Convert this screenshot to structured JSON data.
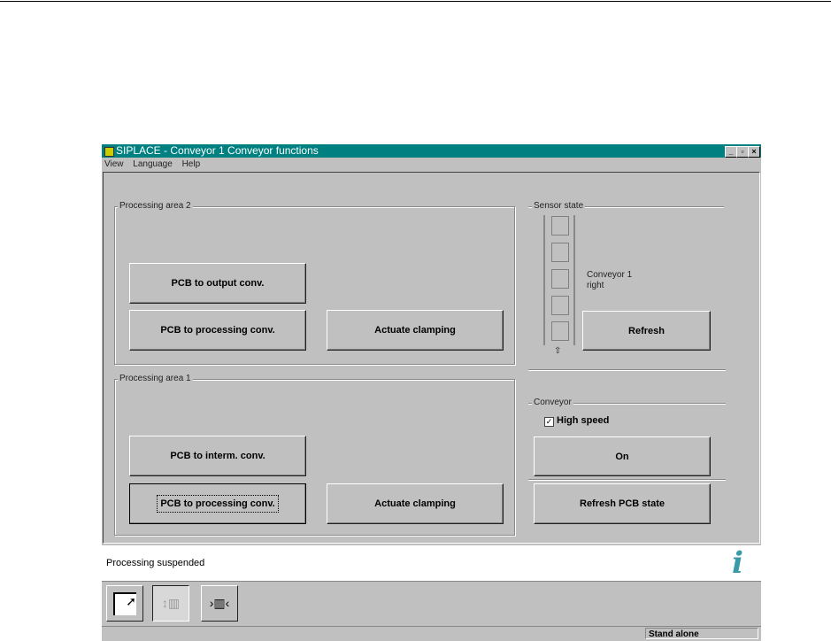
{
  "window": {
    "title": "SIPLACE - Conveyor 1 Conveyor functions"
  },
  "menu": [
    "View",
    "Language",
    "Help"
  ],
  "area2": {
    "label": "Processing area 2",
    "btn_output": "PCB to output conv.",
    "btn_processing": "PCB to processing conv.",
    "btn_clamp": "Actuate clamping"
  },
  "area1": {
    "label": "Processing area 1",
    "btn_interm": "PCB to interm. conv.",
    "btn_processing": "PCB to processing conv.",
    "btn_clamp": "Actuate clamping"
  },
  "sensor": {
    "label": "Sensor state",
    "conveyor_line1": "Conveyor 1",
    "conveyor_line2": "right",
    "arrow": "⇧",
    "refresh": "Refresh"
  },
  "conveyor": {
    "label": "Conveyor",
    "high_speed_label": "High speed",
    "high_speed_checked": true,
    "on": "On",
    "refresh_pcb": "Refresh PCB state"
  },
  "status": {
    "message": "Processing suspended",
    "mode": "Stand alone"
  }
}
